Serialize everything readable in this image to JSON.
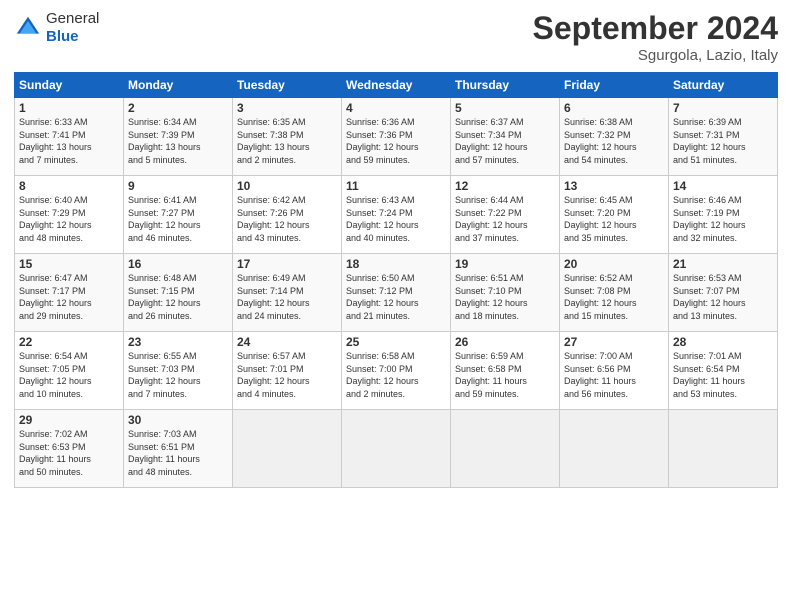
{
  "header": {
    "logo_line1": "General",
    "logo_line2": "Blue",
    "month": "September 2024",
    "location": "Sgurgola, Lazio, Italy"
  },
  "weekdays": [
    "Sunday",
    "Monday",
    "Tuesday",
    "Wednesday",
    "Thursday",
    "Friday",
    "Saturday"
  ],
  "weeks": [
    [
      {
        "day": "1",
        "info": "Sunrise: 6:33 AM\nSunset: 7:41 PM\nDaylight: 13 hours\nand 7 minutes."
      },
      {
        "day": "2",
        "info": "Sunrise: 6:34 AM\nSunset: 7:39 PM\nDaylight: 13 hours\nand 5 minutes."
      },
      {
        "day": "3",
        "info": "Sunrise: 6:35 AM\nSunset: 7:38 PM\nDaylight: 13 hours\nand 2 minutes."
      },
      {
        "day": "4",
        "info": "Sunrise: 6:36 AM\nSunset: 7:36 PM\nDaylight: 12 hours\nand 59 minutes."
      },
      {
        "day": "5",
        "info": "Sunrise: 6:37 AM\nSunset: 7:34 PM\nDaylight: 12 hours\nand 57 minutes."
      },
      {
        "day": "6",
        "info": "Sunrise: 6:38 AM\nSunset: 7:32 PM\nDaylight: 12 hours\nand 54 minutes."
      },
      {
        "day": "7",
        "info": "Sunrise: 6:39 AM\nSunset: 7:31 PM\nDaylight: 12 hours\nand 51 minutes."
      }
    ],
    [
      {
        "day": "8",
        "info": "Sunrise: 6:40 AM\nSunset: 7:29 PM\nDaylight: 12 hours\nand 48 minutes."
      },
      {
        "day": "9",
        "info": "Sunrise: 6:41 AM\nSunset: 7:27 PM\nDaylight: 12 hours\nand 46 minutes."
      },
      {
        "day": "10",
        "info": "Sunrise: 6:42 AM\nSunset: 7:26 PM\nDaylight: 12 hours\nand 43 minutes."
      },
      {
        "day": "11",
        "info": "Sunrise: 6:43 AM\nSunset: 7:24 PM\nDaylight: 12 hours\nand 40 minutes."
      },
      {
        "day": "12",
        "info": "Sunrise: 6:44 AM\nSunset: 7:22 PM\nDaylight: 12 hours\nand 37 minutes."
      },
      {
        "day": "13",
        "info": "Sunrise: 6:45 AM\nSunset: 7:20 PM\nDaylight: 12 hours\nand 35 minutes."
      },
      {
        "day": "14",
        "info": "Sunrise: 6:46 AM\nSunset: 7:19 PM\nDaylight: 12 hours\nand 32 minutes."
      }
    ],
    [
      {
        "day": "15",
        "info": "Sunrise: 6:47 AM\nSunset: 7:17 PM\nDaylight: 12 hours\nand 29 minutes."
      },
      {
        "day": "16",
        "info": "Sunrise: 6:48 AM\nSunset: 7:15 PM\nDaylight: 12 hours\nand 26 minutes."
      },
      {
        "day": "17",
        "info": "Sunrise: 6:49 AM\nSunset: 7:14 PM\nDaylight: 12 hours\nand 24 minutes."
      },
      {
        "day": "18",
        "info": "Sunrise: 6:50 AM\nSunset: 7:12 PM\nDaylight: 12 hours\nand 21 minutes."
      },
      {
        "day": "19",
        "info": "Sunrise: 6:51 AM\nSunset: 7:10 PM\nDaylight: 12 hours\nand 18 minutes."
      },
      {
        "day": "20",
        "info": "Sunrise: 6:52 AM\nSunset: 7:08 PM\nDaylight: 12 hours\nand 15 minutes."
      },
      {
        "day": "21",
        "info": "Sunrise: 6:53 AM\nSunset: 7:07 PM\nDaylight: 12 hours\nand 13 minutes."
      }
    ],
    [
      {
        "day": "22",
        "info": "Sunrise: 6:54 AM\nSunset: 7:05 PM\nDaylight: 12 hours\nand 10 minutes."
      },
      {
        "day": "23",
        "info": "Sunrise: 6:55 AM\nSunset: 7:03 PM\nDaylight: 12 hours\nand 7 minutes."
      },
      {
        "day": "24",
        "info": "Sunrise: 6:57 AM\nSunset: 7:01 PM\nDaylight: 12 hours\nand 4 minutes."
      },
      {
        "day": "25",
        "info": "Sunrise: 6:58 AM\nSunset: 7:00 PM\nDaylight: 12 hours\nand 2 minutes."
      },
      {
        "day": "26",
        "info": "Sunrise: 6:59 AM\nSunset: 6:58 PM\nDaylight: 11 hours\nand 59 minutes."
      },
      {
        "day": "27",
        "info": "Sunrise: 7:00 AM\nSunset: 6:56 PM\nDaylight: 11 hours\nand 56 minutes."
      },
      {
        "day": "28",
        "info": "Sunrise: 7:01 AM\nSunset: 6:54 PM\nDaylight: 11 hours\nand 53 minutes."
      }
    ],
    [
      {
        "day": "29",
        "info": "Sunrise: 7:02 AM\nSunset: 6:53 PM\nDaylight: 11 hours\nand 50 minutes."
      },
      {
        "day": "30",
        "info": "Sunrise: 7:03 AM\nSunset: 6:51 PM\nDaylight: 11 hours\nand 48 minutes."
      },
      {
        "day": "",
        "info": ""
      },
      {
        "day": "",
        "info": ""
      },
      {
        "day": "",
        "info": ""
      },
      {
        "day": "",
        "info": ""
      },
      {
        "day": "",
        "info": ""
      }
    ]
  ]
}
